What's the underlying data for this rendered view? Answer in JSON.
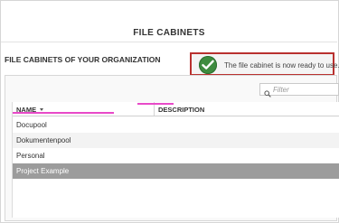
{
  "header": {
    "title": "FILE CABINETS"
  },
  "section": {
    "title": "FILE CABINETS OF YOUR ORGANIZATION"
  },
  "notification": {
    "message": "The file cabinet is now ready to use.",
    "icon": "check-circle-icon",
    "border_color": "#b9312f",
    "icon_color": "#3e8c3f"
  },
  "filter": {
    "placeholder": "Filter",
    "icon": "search-icon"
  },
  "table": {
    "columns": [
      {
        "label": "NAME",
        "sorted": "descending"
      },
      {
        "label": "DESCRIPTION"
      }
    ],
    "rows": [
      {
        "name": "Docupool",
        "description": ""
      },
      {
        "name": "Dokumentenpool",
        "description": ""
      },
      {
        "name": "Personal",
        "description": ""
      },
      {
        "name": "Project Example",
        "description": "",
        "selected": true
      }
    ]
  },
  "colors": {
    "selected_row": "#9c9c9c",
    "accent": "#e84ac8"
  }
}
